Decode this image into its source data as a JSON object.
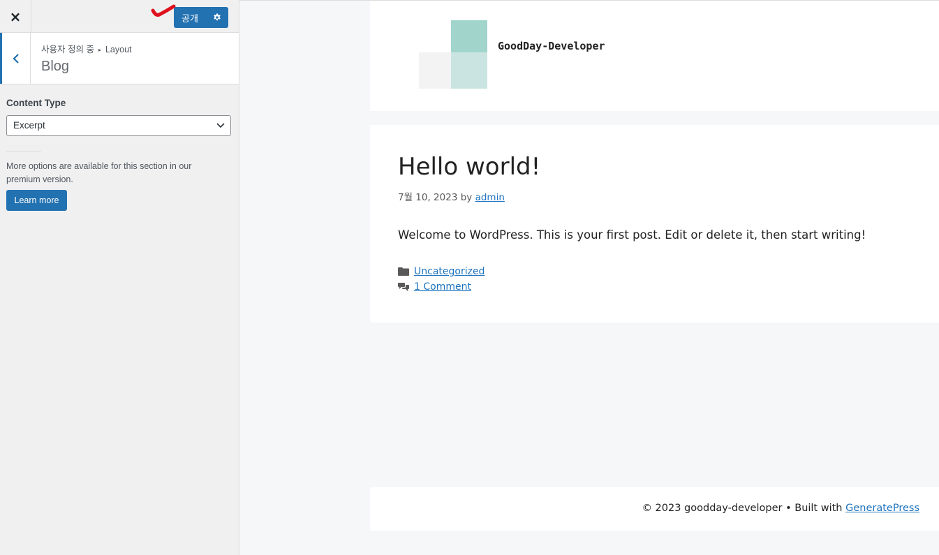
{
  "customizer": {
    "close_label": "×",
    "publish_label": "공개",
    "breadcrumb": {
      "parent": "사용자 정의 중",
      "separator": "▸",
      "current": "Layout"
    },
    "section_title": "Blog",
    "content_type": {
      "label": "Content Type",
      "selected": "Excerpt"
    },
    "premium_note": "More options are available for this section in our premium version.",
    "learn_more_label": "Learn more",
    "accent_color": "#2271b1"
  },
  "preview": {
    "site_title": "GoodDay-Developer",
    "post": {
      "title": "Hello world!",
      "date": "7월 10, 2023",
      "by": "by",
      "author": "admin",
      "body": "Welcome to WordPress. This is your first post. Edit or delete it, then start writing!",
      "category": "Uncategorized",
      "comments": "1 Comment"
    },
    "footer": {
      "copyright": "© 2023 goodday-developer • Built with",
      "theme_link": "GeneratePress"
    },
    "link_color": "#1e73be"
  }
}
